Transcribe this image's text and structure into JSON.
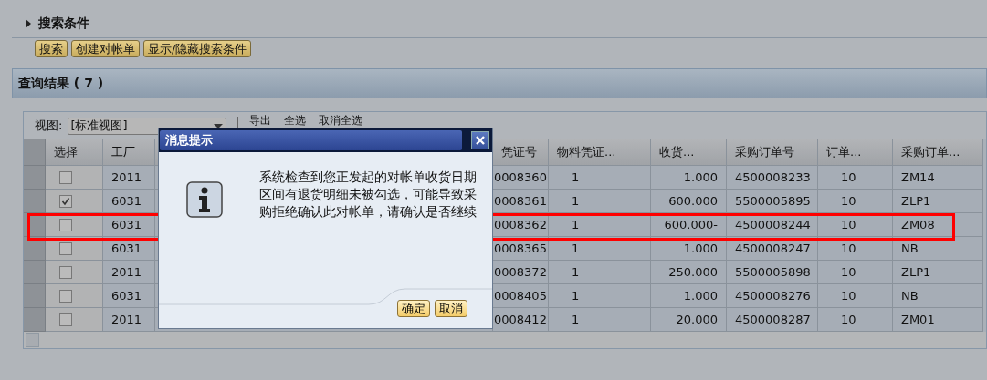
{
  "search_section": {
    "title": "搜索条件",
    "expanded": false
  },
  "buttons": [
    "搜索",
    "创建对帐单",
    "显示/隐藏搜索条件"
  ],
  "results": {
    "title": "查询结果 ( 7 )",
    "toolbar": {
      "view_label": "视图:",
      "view_value": "[标准视图]",
      "actions": [
        "导出",
        "全选",
        "取消全选"
      ]
    },
    "columns": [
      {
        "kind": "check",
        "label": "选择"
      },
      {
        "kind": "text",
        "label": "工厂"
      },
      {
        "kind": "hidden"
      },
      {
        "kind": "text",
        "label": "凭证号"
      },
      {
        "kind": "text",
        "label": "物料凭证..."
      },
      {
        "kind": "number",
        "label": "收货..."
      },
      {
        "kind": "text",
        "label": "采购订单号"
      },
      {
        "kind": "text",
        "label": "订单..."
      },
      {
        "kind": "text",
        "label": "采购订单..."
      }
    ],
    "rows": [
      {
        "checked": false,
        "cells": [
          "",
          "2011",
          "",
          "0008360",
          "1",
          "1.000",
          "4500008233",
          "10",
          "ZM14"
        ]
      },
      {
        "checked": true,
        "cells": [
          "",
          "6031",
          "",
          "0008361",
          "1",
          "600.000",
          "5500005895",
          "10",
          "ZLP1"
        ]
      },
      {
        "checked": false,
        "cells": [
          "",
          "6031",
          "",
          "0008362",
          "1",
          "600.000-",
          "4500008244",
          "10",
          "ZM08"
        ]
      },
      {
        "checked": false,
        "cells": [
          "",
          "6031",
          "",
          "0008365",
          "1",
          "1.000",
          "4500008247",
          "10",
          "NB"
        ]
      },
      {
        "checked": false,
        "cells": [
          "",
          "2011",
          "",
          "0008372",
          "1",
          "250.000",
          "5500005898",
          "10",
          "ZLP1"
        ]
      },
      {
        "checked": false,
        "cells": [
          "",
          "6031",
          "",
          "0008405",
          "1",
          "1.000",
          "4500008276",
          "10",
          "NB"
        ]
      },
      {
        "checked": false,
        "cells": [
          "",
          "2011",
          "",
          "0008412",
          "1",
          "20.000",
          "4500008287",
          "10",
          "ZM01"
        ]
      }
    ]
  },
  "dialog": {
    "title": "消息提示",
    "message": "系统检查到您正发起的对帐单收货日期区间有退货明细未被勾选，可能导致采购拒绝确认此对帐单，请确认是否继续",
    "buttons": [
      "确定",
      "取消"
    ]
  }
}
